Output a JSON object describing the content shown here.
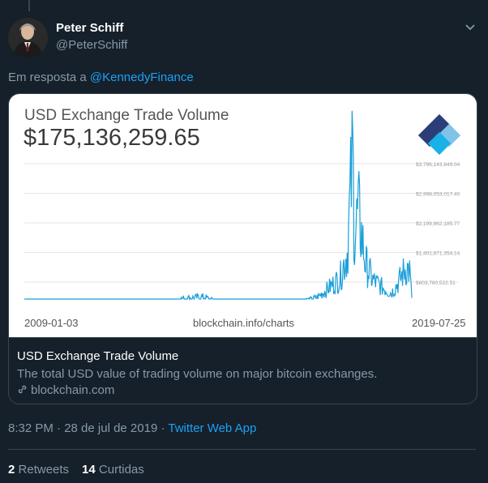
{
  "tweet": {
    "author_name": "Peter Schiff",
    "author_handle": "@PeterSchiff",
    "reply_prefix": "Em resposta a",
    "reply_to": "@KennedyFinance",
    "timestamp": "8:32 PM · 28 de jul de 2019 · ",
    "source": "Twitter Web App",
    "retweets_count": "2",
    "retweets_label": "Retweets",
    "likes_count": "14",
    "likes_label": "Curtidas"
  },
  "card": {
    "title": "USD Exchange Trade Volume",
    "description": "The total USD value of trading volume on major bitcoin exchanges.",
    "domain": "blockchain.com"
  },
  "chart": {
    "heading": "USD Exchange Trade Volume",
    "big_value": "$175,136,259.65",
    "footer_left": "2009-01-03",
    "footer_center": "blockchain.info/charts",
    "footer_right": "2019-07-25",
    "logo_colors": [
      "#1ab1e8",
      "#2c3e78",
      "#7fc3e9"
    ]
  },
  "chart_data": {
    "type": "line",
    "x_range": [
      "2009-01-03",
      "2019-07-25"
    ],
    "y_tick_labels": [
      "$3,796,143,849.04",
      "$2,998,053,017.40",
      "$2,199,962,185.77",
      "$1,401,871,354.14",
      "$603,780,522.51"
    ],
    "y_ticks": [
      3796143849.04,
      2998053017.4,
      2199962185.77,
      1401871354.14,
      603780522.51
    ],
    "x": [
      2009.0,
      2010.0,
      2011.0,
      2011.5,
      2012.0,
      2013.0,
      2013.3,
      2013.9,
      2014.2,
      2015.0,
      2016.0,
      2016.8,
      2017.0,
      2017.3,
      2017.6,
      2017.8,
      2017.95,
      2018.0,
      2018.1,
      2018.3,
      2018.5,
      2018.7,
      2019.0,
      2019.2,
      2019.4,
      2019.5,
      2019.56
    ],
    "values": [
      0,
      0,
      5000000,
      30000000,
      10000000,
      30000000,
      160000000,
      200000000,
      90000000,
      80000000,
      90000000,
      130000000,
      200000000,
      450000000,
      700000000,
      1400000000,
      4000000000,
      1800000000,
      2500000000,
      1100000000,
      650000000,
      500000000,
      300000000,
      600000000,
      1000000000,
      900000000,
      175136259.65
    ],
    "line_color": "#1a9fd8",
    "grid": true
  }
}
